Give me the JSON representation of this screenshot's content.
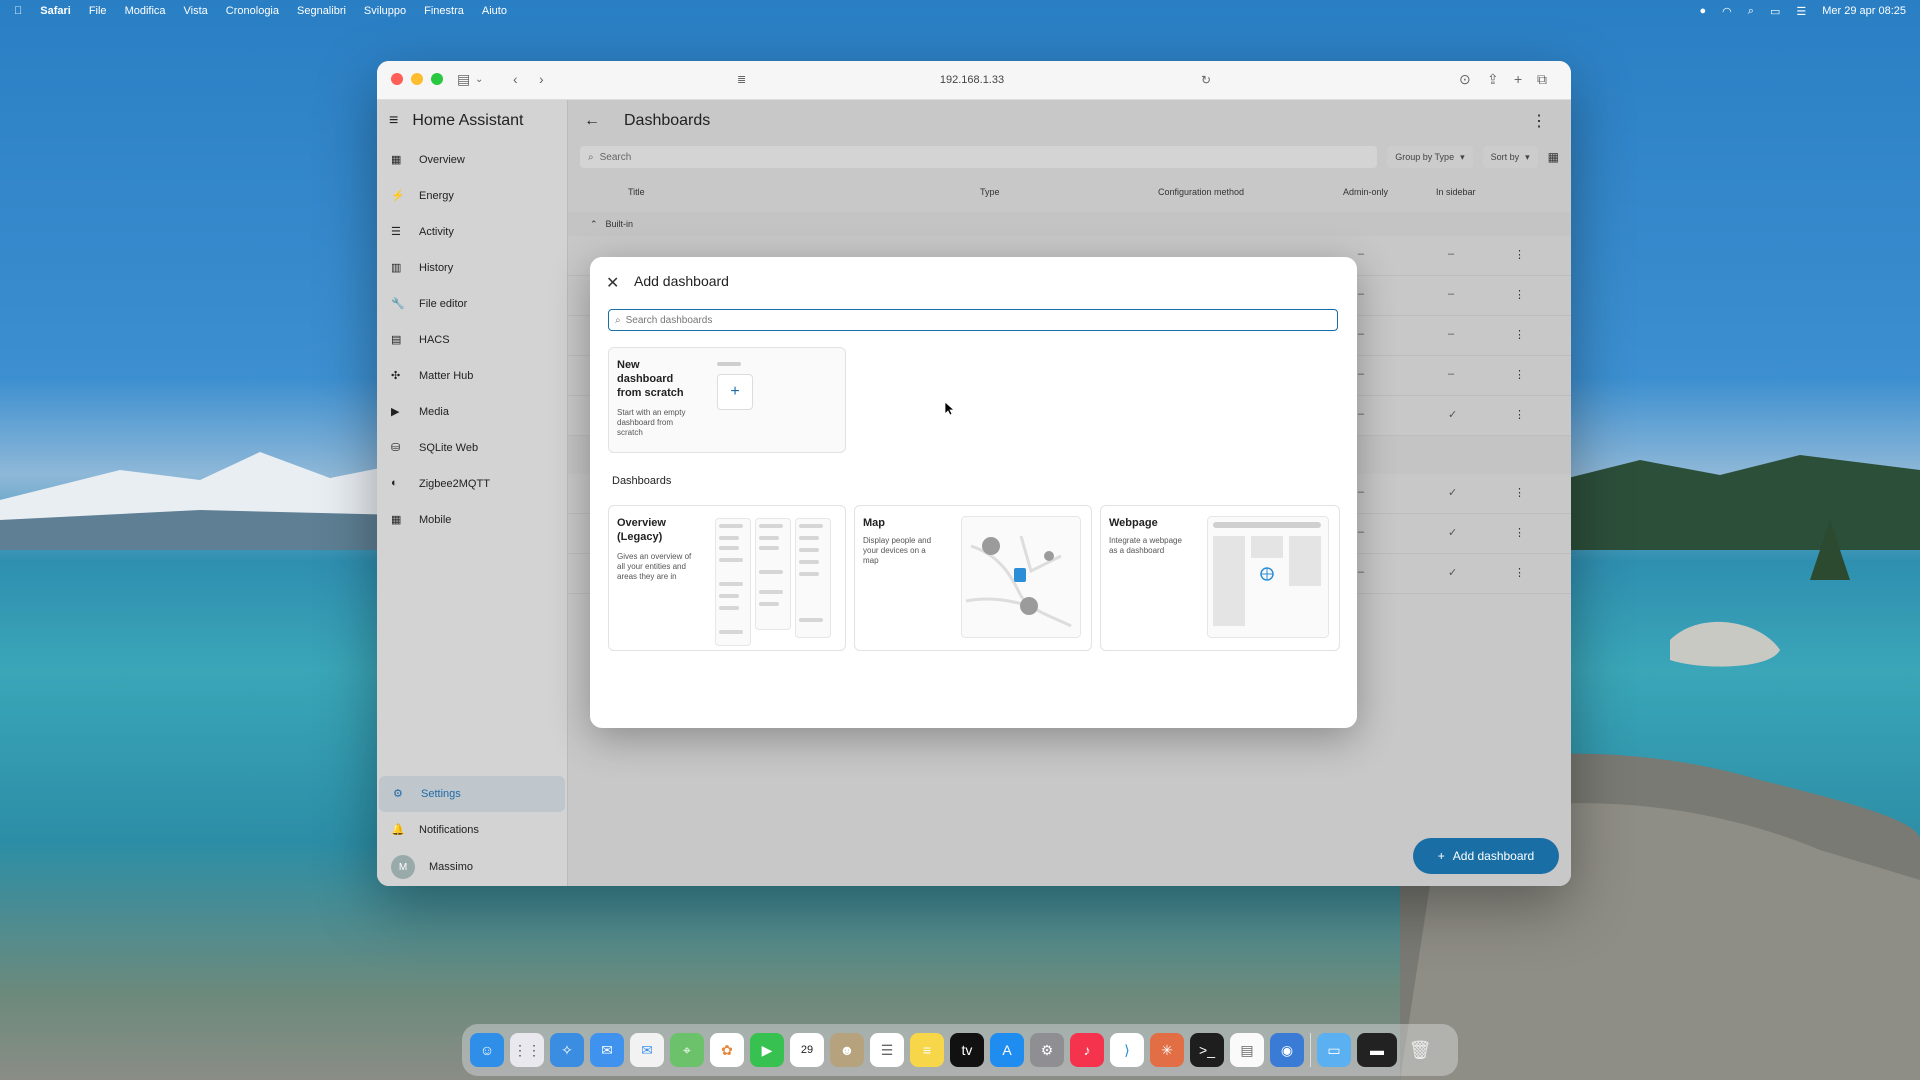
{
  "menubar": {
    "app": "Safari",
    "menus": [
      "File",
      "Modifica",
      "Vista",
      "Cronologia",
      "Segnalibri",
      "Sviluppo",
      "Finestra",
      "Aiuto"
    ],
    "datetime": "Mer 29 apr 08:25"
  },
  "browser": {
    "url": "192.168.1.33"
  },
  "sidebar": {
    "title": "Home Assistant",
    "items": [
      {
        "label": "Overview",
        "icon": "grid-icon"
      },
      {
        "label": "Energy",
        "icon": "lightning-icon"
      },
      {
        "label": "Activity",
        "icon": "list-icon"
      },
      {
        "label": "History",
        "icon": "chart-icon"
      },
      {
        "label": "File editor",
        "icon": "wrench-icon"
      },
      {
        "label": "HACS",
        "icon": "store-icon"
      },
      {
        "label": "Matter Hub",
        "icon": "hub-icon"
      },
      {
        "label": "Media",
        "icon": "play-icon"
      },
      {
        "label": "SQLite Web",
        "icon": "database-icon"
      },
      {
        "label": "Zigbee2MQTT",
        "icon": "zigbee-icon"
      },
      {
        "label": "Mobile",
        "icon": "grid-icon"
      }
    ],
    "settings": "Settings",
    "notifications": "Notifications",
    "user": "Massimo",
    "user_initial": "M"
  },
  "main": {
    "title": "Dashboards",
    "search_placeholder": "Search",
    "group_by": "Group by Type",
    "sort_by": "Sort by",
    "columns": [
      "Title",
      "Type",
      "Configuration method",
      "Admin-only",
      "In sidebar"
    ],
    "group_label": "Built-in",
    "rows": [
      {
        "admin": "–",
        "sidebar": "–"
      },
      {
        "admin": "–",
        "sidebar": "–"
      },
      {
        "admin": "–",
        "sidebar": "–"
      },
      {
        "admin": "–",
        "sidebar": "–"
      },
      {
        "admin": "–",
        "sidebar": "✓"
      },
      {
        "admin": "–",
        "sidebar": "✓"
      },
      {
        "admin": "–",
        "sidebar": "✓"
      },
      {
        "admin": "–",
        "sidebar": "✓"
      }
    ],
    "add_button": "Add dashboard"
  },
  "dialog": {
    "title": "Add dashboard",
    "search_placeholder": "Search dashboards",
    "scratch": {
      "title": "New dashboard from scratch",
      "desc": "Start with an empty dashboard from scratch"
    },
    "section": "Dashboards",
    "cards": [
      {
        "title": "Overview (Legacy)",
        "desc": "Gives an overview of all your entities and areas they are in"
      },
      {
        "title": "Map",
        "desc": "Display people and your devices on a map"
      },
      {
        "title": "Webpage",
        "desc": "Integrate a webpage as a dashboard"
      }
    ]
  },
  "colors": {
    "accent": "#1a6ea6"
  }
}
